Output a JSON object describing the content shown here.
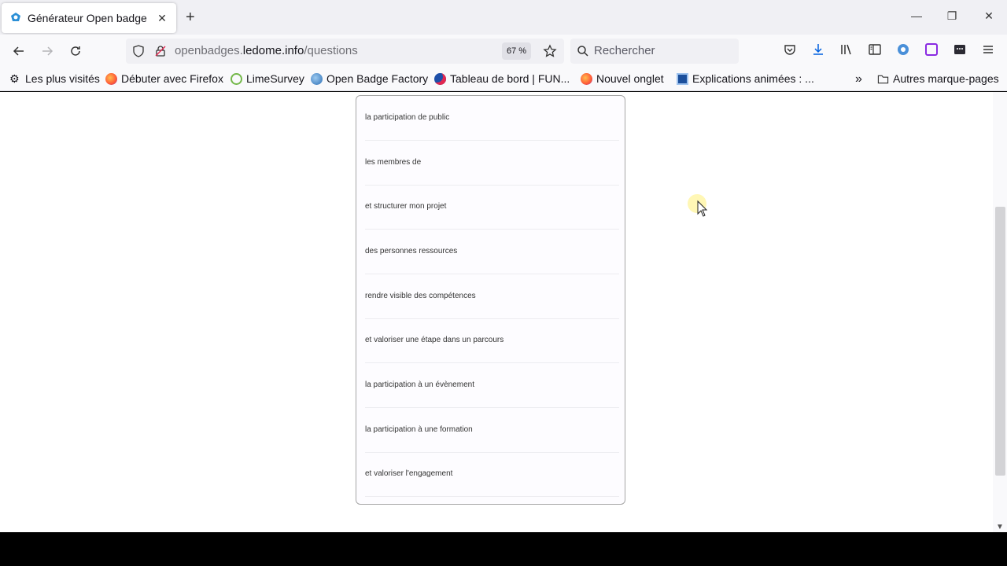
{
  "tab": {
    "title": "Générateur Open badge",
    "close": "✕"
  },
  "newtab": "+",
  "window": {
    "minimize": "—",
    "restore": "❐",
    "close": "✕"
  },
  "urlbar": {
    "url_prefix": "openbadges.",
    "url_domain": "ledome.info",
    "url_path": "/questions",
    "zoom": "67 %"
  },
  "search": {
    "placeholder": "Rechercher"
  },
  "bookmarks": [
    {
      "label": "Les plus visités",
      "icon": "gear-icon"
    },
    {
      "label": "Débuter avec Firefox",
      "icon": "firefox-icon"
    },
    {
      "label": "LimeSurvey",
      "icon": "limesurvey-icon"
    },
    {
      "label": "Open Badge Factory",
      "icon": "globe-icon"
    },
    {
      "label": "Tableau de bord | FUN...",
      "icon": "fun-icon"
    },
    {
      "label": "Nouvel onglet",
      "icon": "firefox-icon"
    },
    {
      "label": "Explications animées : ...",
      "icon": "video-icon"
    }
  ],
  "bookmarks_more": "»",
  "other_bookmarks": "Autres marque-pages",
  "answers": [
    "la participation de public",
    "les membres de",
    "et structurer mon projet",
    "des personnes ressources",
    "rendre visible des compétences",
    "et valoriser une étape dans un parcours",
    "la participation à un évènement",
    "la participation à une formation",
    "et valoriser l'engagement"
  ],
  "colors": {
    "accent": "#0060df",
    "tabstrip": "#f0f0f4",
    "toolbar": "#f9f9fb"
  }
}
